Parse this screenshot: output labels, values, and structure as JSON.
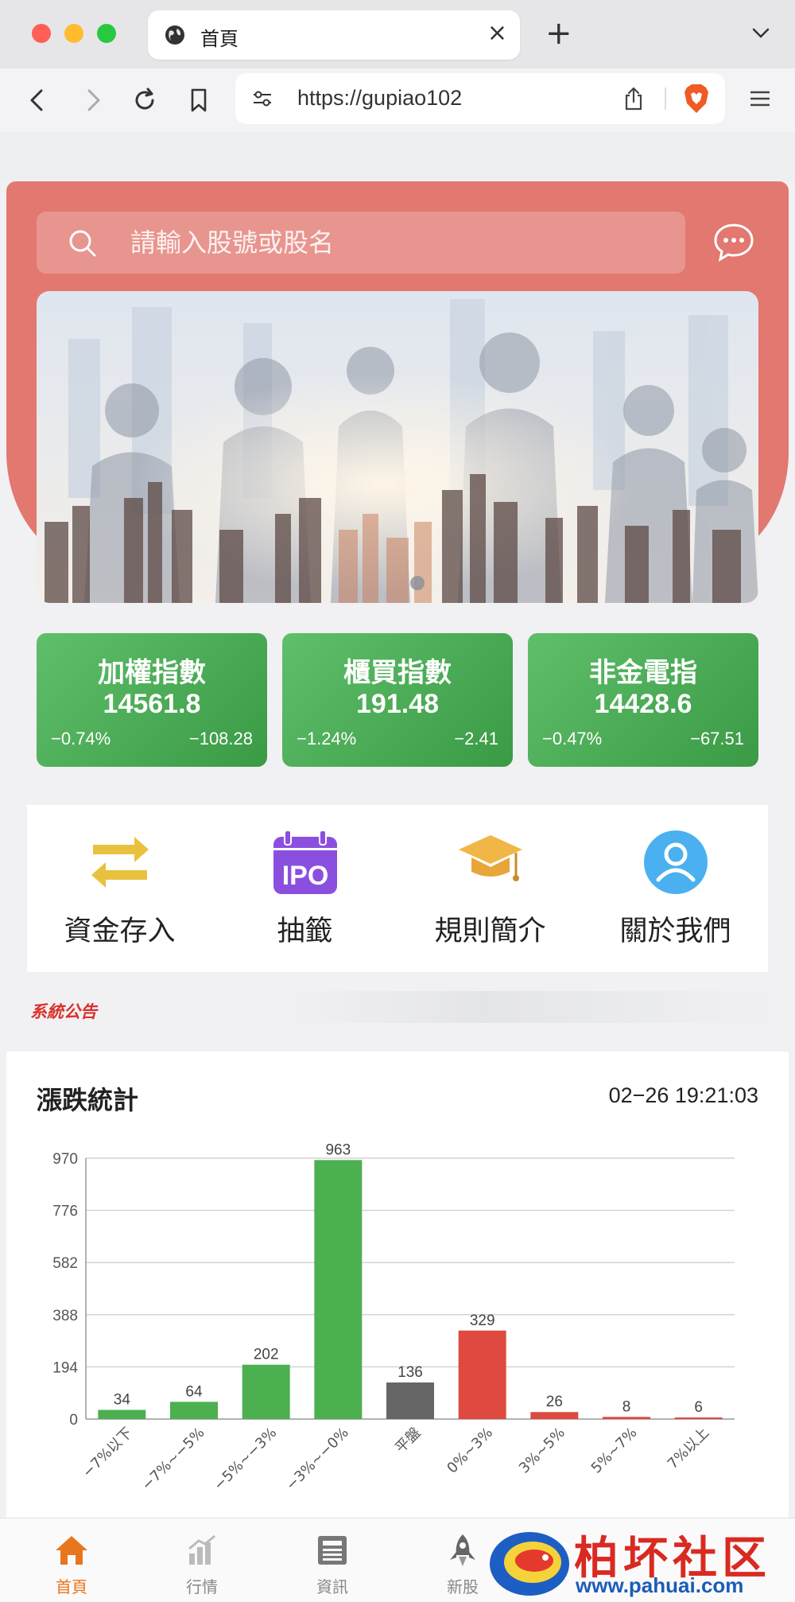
{
  "browser": {
    "tab_title": "首頁",
    "url": "https://gupiao102"
  },
  "search": {
    "placeholder": "請輸入股號或股名"
  },
  "indices": [
    {
      "name": "加權指數",
      "value": "14561.8",
      "pct": "−0.74%",
      "change": "−108.28"
    },
    {
      "name": "櫃買指數",
      "value": "191.48",
      "pct": "−1.24%",
      "change": "−2.41"
    },
    {
      "name": "非金電指",
      "value": "14428.6",
      "pct": "−0.47%",
      "change": "−67.51"
    }
  ],
  "menu": [
    {
      "label": "資金存入",
      "icon": "transfer-arrows-icon"
    },
    {
      "label": "抽籤",
      "icon": "ipo-calendar-icon"
    },
    {
      "label": "規則簡介",
      "icon": "graduation-cap-icon"
    },
    {
      "label": "關於我們",
      "icon": "user-avatar-icon"
    }
  ],
  "notice": {
    "label": "系統公告"
  },
  "stats": {
    "title": "漲跌統計",
    "time": "02−26 19:21:03"
  },
  "chart_data": {
    "type": "bar",
    "categories": [
      "−7%以下",
      "−7%~−5%",
      "−5%~−3%",
      "−3%~−0%",
      "平盤",
      "0%~3%",
      "3%~5%",
      "5%~7%",
      "7%以上"
    ],
    "values": [
      34,
      64,
      202,
      963,
      136,
      329,
      26,
      8,
      6
    ],
    "colors": [
      "#4caf50",
      "#4caf50",
      "#4caf50",
      "#4caf50",
      "#666666",
      "#de4a3f",
      "#de4a3f",
      "#de4a3f",
      "#de4a3f"
    ],
    "yticks": [
      0,
      194,
      388,
      582,
      776,
      970
    ],
    "ylim": [
      0,
      970
    ],
    "grid": true
  },
  "bottom_nav": [
    {
      "label": "首頁",
      "icon": "home-icon",
      "active": true
    },
    {
      "label": "行情",
      "icon": "bar-chart-icon",
      "active": false
    },
    {
      "label": "資訊",
      "icon": "newspaper-icon",
      "active": false
    },
    {
      "label": "新股",
      "icon": "rocket-icon",
      "active": false
    }
  ],
  "watermark": {
    "text": "柏坏社区",
    "url": "www.pahuai.com"
  },
  "colors": {
    "hero": "#e27870",
    "index_green": "#4caf50",
    "up_red": "#de4a3f",
    "flat_gray": "#666666",
    "nav_active": "#e8761e"
  }
}
